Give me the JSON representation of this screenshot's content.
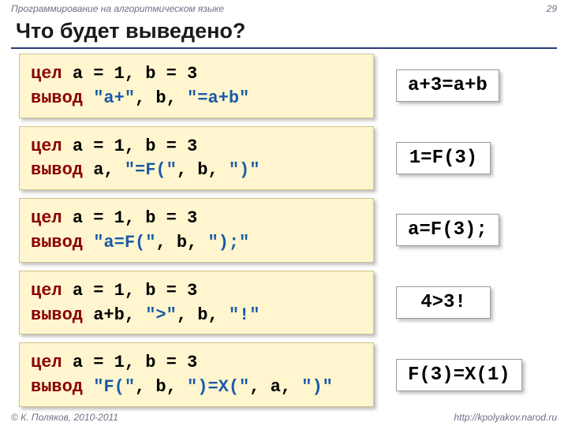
{
  "header": {
    "course": "Программирование на алгоритмическом языке",
    "page": "29"
  },
  "title": "Что будет выведено?",
  "footer": {
    "copyright": "© К. Поляков, 2010-2011",
    "url": "http://kpolyakov.narod.ru"
  },
  "rows": [
    {
      "code": [
        [
          {
            "t": "цел ",
            "c": "kw"
          },
          {
            "t": "a",
            "c": "id"
          },
          {
            "t": " = ",
            "c": "op"
          },
          {
            "t": "1",
            "c": "id"
          },
          {
            "t": ",",
            "c": "op"
          },
          {
            "t": " b",
            "c": "id"
          },
          {
            "t": " = ",
            "c": "op"
          },
          {
            "t": "3",
            "c": "id"
          }
        ],
        [
          {
            "t": "вывод ",
            "c": "kw"
          },
          {
            "t": "\"a+\"",
            "c": "str"
          },
          {
            "t": ",",
            "c": "op"
          },
          {
            "t": " b",
            "c": "id"
          },
          {
            "t": ",",
            "c": "op"
          },
          {
            "t": " \"=a+b\"",
            "c": "str"
          }
        ]
      ],
      "out": "a+3=a+b"
    },
    {
      "code": [
        [
          {
            "t": "цел ",
            "c": "kw"
          },
          {
            "t": "a",
            "c": "id"
          },
          {
            "t": " = ",
            "c": "op"
          },
          {
            "t": "1",
            "c": "id"
          },
          {
            "t": ",",
            "c": "op"
          },
          {
            "t": " b",
            "c": "id"
          },
          {
            "t": " = ",
            "c": "op"
          },
          {
            "t": "3",
            "c": "id"
          }
        ],
        [
          {
            "t": "вывод ",
            "c": "kw"
          },
          {
            "t": "a",
            "c": "id"
          },
          {
            "t": ",",
            "c": "op"
          },
          {
            "t": " \"=F(\"",
            "c": "str"
          },
          {
            "t": ",",
            "c": "op"
          },
          {
            "t": " b",
            "c": "id"
          },
          {
            "t": ",",
            "c": "op"
          },
          {
            "t": " \")\"",
            "c": "str"
          }
        ]
      ],
      "out": "1=F(3)"
    },
    {
      "code": [
        [
          {
            "t": "цел ",
            "c": "kw"
          },
          {
            "t": "a",
            "c": "id"
          },
          {
            "t": " = ",
            "c": "op"
          },
          {
            "t": "1",
            "c": "id"
          },
          {
            "t": ",",
            "c": "op"
          },
          {
            "t": " b",
            "c": "id"
          },
          {
            "t": " = ",
            "c": "op"
          },
          {
            "t": "3",
            "c": "id"
          }
        ],
        [
          {
            "t": "вывод ",
            "c": "kw"
          },
          {
            "t": "\"a=F(\"",
            "c": "str"
          },
          {
            "t": ",",
            "c": "op"
          },
          {
            "t": " b",
            "c": "id"
          },
          {
            "t": ",",
            "c": "op"
          },
          {
            "t": " \");\"",
            "c": "str"
          }
        ]
      ],
      "out": "a=F(3);"
    },
    {
      "code": [
        [
          {
            "t": "цел ",
            "c": "kw"
          },
          {
            "t": "a",
            "c": "id"
          },
          {
            "t": " = ",
            "c": "op"
          },
          {
            "t": "1",
            "c": "id"
          },
          {
            "t": ",",
            "c": "op"
          },
          {
            "t": " b",
            "c": "id"
          },
          {
            "t": " = ",
            "c": "op"
          },
          {
            "t": "3",
            "c": "id"
          }
        ],
        [
          {
            "t": "вывод ",
            "c": "kw"
          },
          {
            "t": "a+b",
            "c": "id"
          },
          {
            "t": ",",
            "c": "op"
          },
          {
            "t": " \">\"",
            "c": "str"
          },
          {
            "t": ",",
            "c": "op"
          },
          {
            "t": " b",
            "c": "id"
          },
          {
            "t": ",",
            "c": "op"
          },
          {
            "t": " \"!\"",
            "c": "str"
          }
        ]
      ],
      "out": "4>3!"
    },
    {
      "code": [
        [
          {
            "t": "цел ",
            "c": "kw"
          },
          {
            "t": "a",
            "c": "id"
          },
          {
            "t": " = ",
            "c": "op"
          },
          {
            "t": "1",
            "c": "id"
          },
          {
            "t": ",",
            "c": "op"
          },
          {
            "t": " b",
            "c": "id"
          },
          {
            "t": " = ",
            "c": "op"
          },
          {
            "t": "3",
            "c": "id"
          }
        ],
        [
          {
            "t": "вывод ",
            "c": "kw"
          },
          {
            "t": "\"F(\"",
            "c": "str"
          },
          {
            "t": ",",
            "c": "op"
          },
          {
            "t": " b",
            "c": "id"
          },
          {
            "t": ",",
            "c": "op"
          },
          {
            "t": " \")=X(\"",
            "c": "str"
          },
          {
            "t": ",",
            "c": "op"
          },
          {
            "t": " a",
            "c": "id"
          },
          {
            "t": ",",
            "c": "op"
          },
          {
            "t": " \")\"",
            "c": "str"
          }
        ]
      ],
      "out": "F(3)=X(1)"
    }
  ]
}
